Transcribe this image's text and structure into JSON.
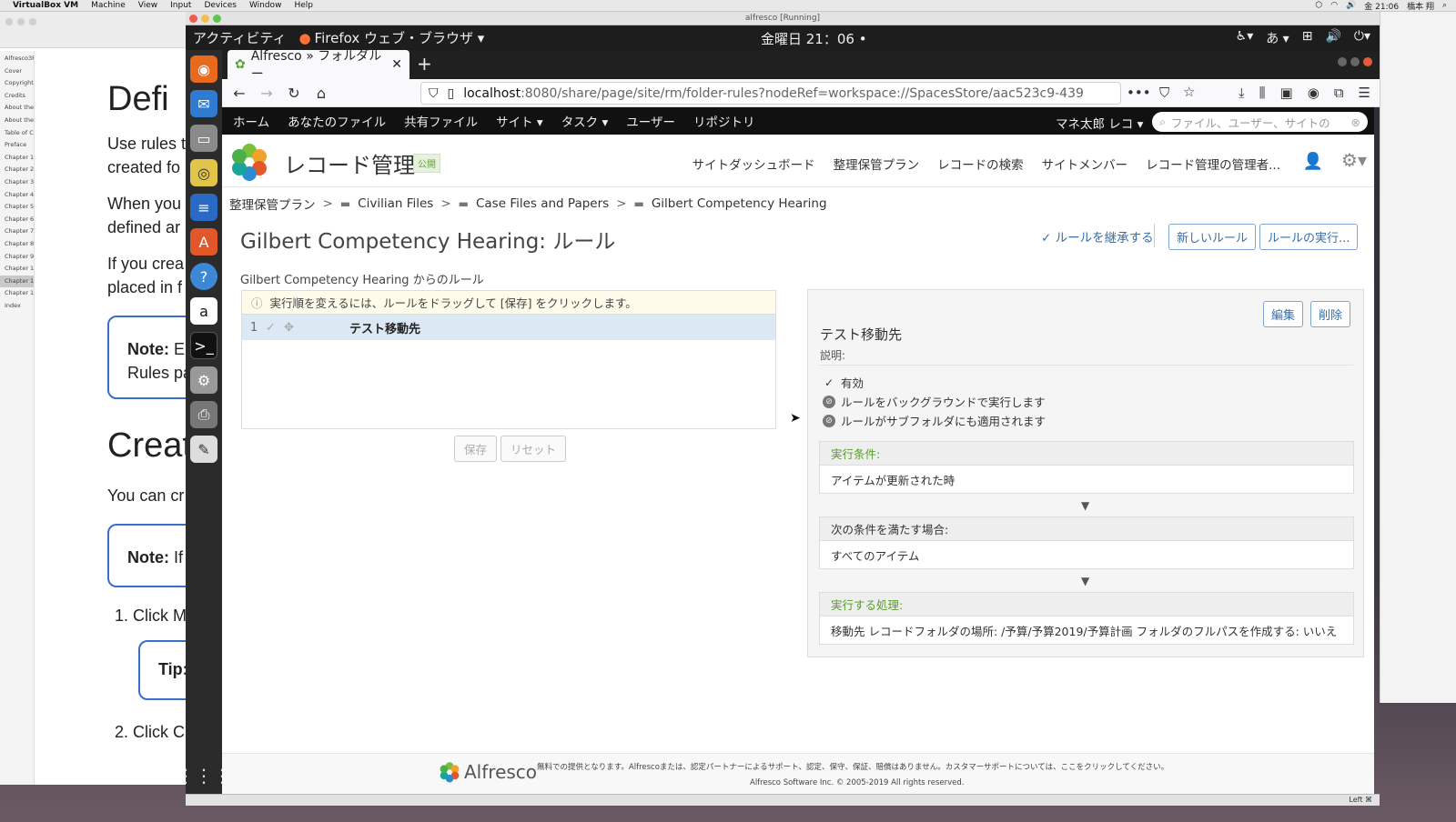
{
  "mac": {
    "app_name": "VirtualBox VM",
    "menus": [
      "Machine",
      "View",
      "Input",
      "Devices",
      "Window",
      "Help"
    ],
    "clock": "金 21:06",
    "user": "橋本 翔"
  },
  "doc_window": {
    "sidebar": [
      "Alfresco3R",
      "Cover",
      "Copyright",
      "Credits",
      "About the",
      "About the",
      "Table of C",
      "Preface",
      "Chapter 1",
      "Chapter 2",
      "Chapter 3",
      "Chapter 4",
      "Chapter 5",
      "Chapter 6",
      "Chapter 7",
      "Chapter 8",
      "Chapter 9",
      "Chapter 1",
      "Chapter 1",
      "Chapter 1",
      "Index"
    ],
    "heading1": "Defi",
    "para1": "Use rules t",
    "para1b": "created fo",
    "para2": "When you",
    "para2b": "defined ar",
    "para3": "If you crea",
    "para3b": "placed in f",
    "note1_bold": "Note:",
    "note1_rest": " E",
    "note1_line2": "Rules pa",
    "heading2": "Creat",
    "para4": "You can cr",
    "note2_bold": "Note:",
    "note2_rest": " If",
    "step1": "1.  Click M",
    "tip": "Tip:",
    "step2": "2.  Click C"
  },
  "vm": {
    "title": "alfresco [Running]",
    "status": "Left ⌘"
  },
  "gnome": {
    "activities": "アクティビティ",
    "app": "Firefox ウェブ・ブラウザ ▾",
    "clock": "金曜日 21：06 •",
    "ime": "あ ▾"
  },
  "firefox": {
    "tab_title": "Alfresco » フォルダルー",
    "url_host": "localhost",
    "url_rest": ":8080/share/page/site/rm/folder-rules?nodeRef=workspace://SpacesStore/aac523c9-439"
  },
  "alfresco_nav": {
    "items": [
      "ホーム",
      "あなたのファイル",
      "共有ファイル",
      "サイト ▾",
      "タスク ▾",
      "ユーザー",
      "リポジトリ"
    ],
    "user": "マネ太郎 レコ ▾",
    "search_placeholder": "ファイル、ユーザー、サイトの"
  },
  "site": {
    "title": "レコード管理",
    "badge": "公開",
    "links": [
      "サイトダッシュボード",
      "整理保管プラン",
      "レコードの検索",
      "サイトメンバー",
      "レコード管理の管理者..."
    ]
  },
  "breadcrumb": [
    "整理保管プラン",
    "Civilian Files",
    "Case Files and Papers",
    "Gilbert Competency Hearing"
  ],
  "page": {
    "title_name": "Gilbert Competency Hearing: ",
    "title_suffix": "ルール",
    "inherit": "ルールを継承する",
    "new_rule": "新しいルール",
    "run_rules": "ルールの実行...",
    "rules_from": "Gilbert Competency Hearing からのルール",
    "hint": "実行順を変えるには、ルールをドラッグして [保存] をクリックします。",
    "save": "保存",
    "reset": "リセット"
  },
  "rules": [
    {
      "index": "1",
      "name": "テスト移動先"
    }
  ],
  "detail": {
    "edit": "編集",
    "delete": "削除",
    "name": "テスト移動先",
    "desc_label": "説明:",
    "flags": [
      "有効",
      "ルールをバックグラウンドで実行します",
      "ルールがサブフォルダにも適用されます"
    ],
    "when_label": "実行条件:",
    "when_value": "アイテムが更新された時",
    "if_label": "次の条件を満たす場合:",
    "if_value": "すべてのアイテム",
    "action_label": "実行する処理:",
    "action_value": "移動先  レコードフォルダの場所:   /予算/予算2019/予算計画  フォルダのフルパスを作成する:   いいえ",
    "arrow": "▼"
  },
  "footer": {
    "logo_text": "Alfresco",
    "text": "無料での提供となります。Alfrescoまたは、認定パートナーによるサポート、認定、保守、保証、賠償はありません。カスタマーサポートについては、ここをクリックしてください。",
    "copyright": "Alfresco Software Inc. © 2005-2019 All rights reserved."
  },
  "colors": {
    "accent_blue": "#3a6ea5",
    "green_label": "#5a9b2e",
    "nav_bg": "#111111"
  }
}
